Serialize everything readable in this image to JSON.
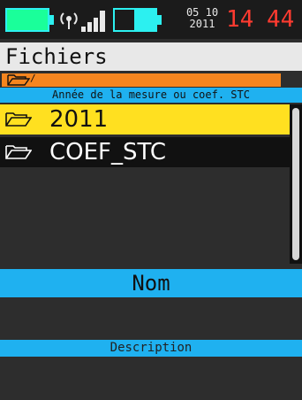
{
  "status": {
    "date_line1": "05 10",
    "date_line2": "2011",
    "time_hour": "14",
    "time_minute": "44",
    "icons": [
      "battery-icon",
      "wifi-icon",
      "signal-icon",
      "battery-icon"
    ],
    "colors": {
      "battery_fill": "#1aff9a",
      "accent_cyan": "#2cf0f0",
      "time": "#ff3b30"
    }
  },
  "header": {
    "title": "Fichiers"
  },
  "path": {
    "current": "/",
    "description": "Année de la mesure ou coef. STC"
  },
  "list": {
    "items": [
      {
        "label": "2011",
        "selected": true,
        "icon": "folder-icon"
      },
      {
        "label": "COEF_STC",
        "selected": false,
        "icon": "folder-icon"
      }
    ]
  },
  "details": {
    "name_label": "Nom",
    "description_label": "Description"
  },
  "colors": {
    "accent_blue": "#1fb1f0",
    "selection": "#ffe020",
    "path_orange": "#f5851f"
  }
}
